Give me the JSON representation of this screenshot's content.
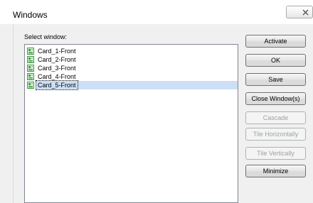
{
  "window": {
    "title": "Windows"
  },
  "select_label": "Select window:",
  "list": {
    "items": [
      {
        "label": "Card_1-Front",
        "selected": false
      },
      {
        "label": "Card_2-Front",
        "selected": false
      },
      {
        "label": "Card_3-Front",
        "selected": false
      },
      {
        "label": "Card_4-Front",
        "selected": false
      },
      {
        "label": "Card_5-Front",
        "selected": true
      }
    ]
  },
  "buttons": {
    "activate": "Activate",
    "ok": "OK",
    "save": "Save",
    "close_windows": "Close Window(s)",
    "cascade": "Cascade",
    "tile_horizontally": "Tile Horizontally",
    "tile_vertically": "Tile Vertically",
    "minimize": "Minimize"
  },
  "colors": {
    "selection": "#cddff7",
    "icon_green": "#3c9a3c",
    "disabled_text": "#a0a0a0"
  },
  "icons": {
    "list_item": "document-icon",
    "close": "close-icon"
  }
}
